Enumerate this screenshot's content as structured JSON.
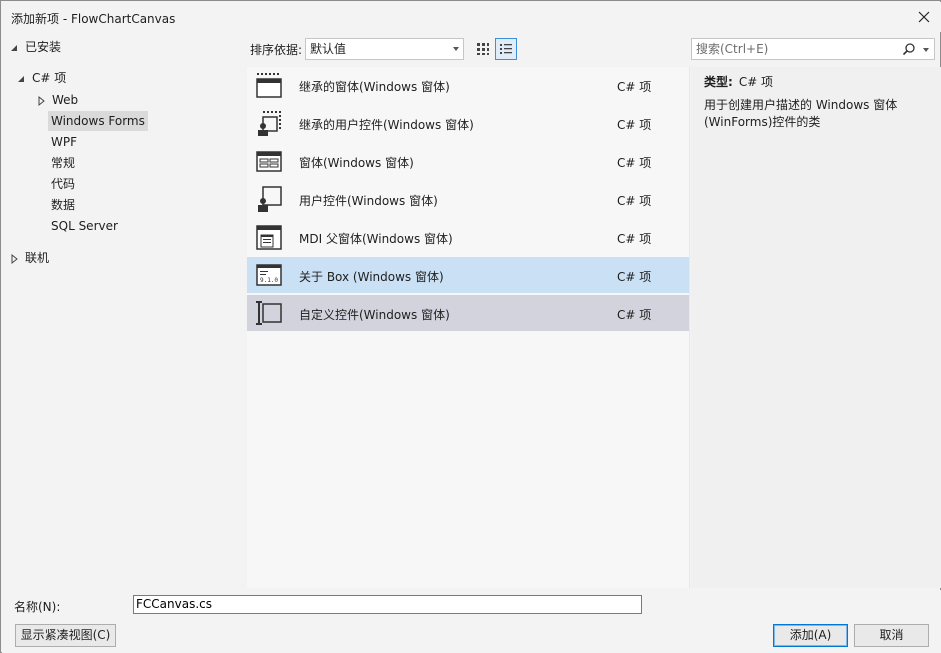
{
  "window": {
    "title": "添加新项 - FlowChartCanvas"
  },
  "tree": {
    "installed": "已安装",
    "csharp": "C# 项",
    "web": "Web",
    "winforms": "Windows Forms",
    "wpf": "WPF",
    "normal": "常规",
    "code": "代码",
    "data": "数据",
    "sql": "SQL Server",
    "online": "联机"
  },
  "toolbar": {
    "sort_label": "排序依据:",
    "sort_value": "默认值",
    "search_placeholder": "搜索(Ctrl+E)"
  },
  "templates": [
    {
      "name": "继承的窗体(Windows 窗体)",
      "lang": "C# 项",
      "icon": "inherited-form-icon"
    },
    {
      "name": "继承的用户控件(Windows 窗体)",
      "lang": "C# 项",
      "icon": "inherited-user-control-icon"
    },
    {
      "name": "窗体(Windows 窗体)",
      "lang": "C# 项",
      "icon": "form-icon"
    },
    {
      "name": "用户控件(Windows 窗体)",
      "lang": "C# 项",
      "icon": "user-control-icon"
    },
    {
      "name": "MDI 父窗体(Windows 窗体)",
      "lang": "C# 项",
      "icon": "mdi-parent-form-icon"
    },
    {
      "name": "关于 Box (Windows 窗体)",
      "lang": "C# 项",
      "icon": "about-box-icon"
    },
    {
      "name": "自定义控件(Windows 窗体)",
      "lang": "C# 项",
      "icon": "custom-control-icon"
    }
  ],
  "details": {
    "type_label": "类型:",
    "type_value": "C# 项",
    "description": "用于创建用户描述的 Windows 窗体(WinForms)控件的类"
  },
  "bottom": {
    "name_label": "名称(N):",
    "name_value": "FCCanvas.cs",
    "compact_button": "显示紧凑视图(C)",
    "add_button": "添加(A)",
    "cancel_button": "取消"
  },
  "colors": {
    "selected_bg": "#d3d3dd",
    "highlight_bg": "#cae0f5",
    "accent": "#0078d4"
  }
}
